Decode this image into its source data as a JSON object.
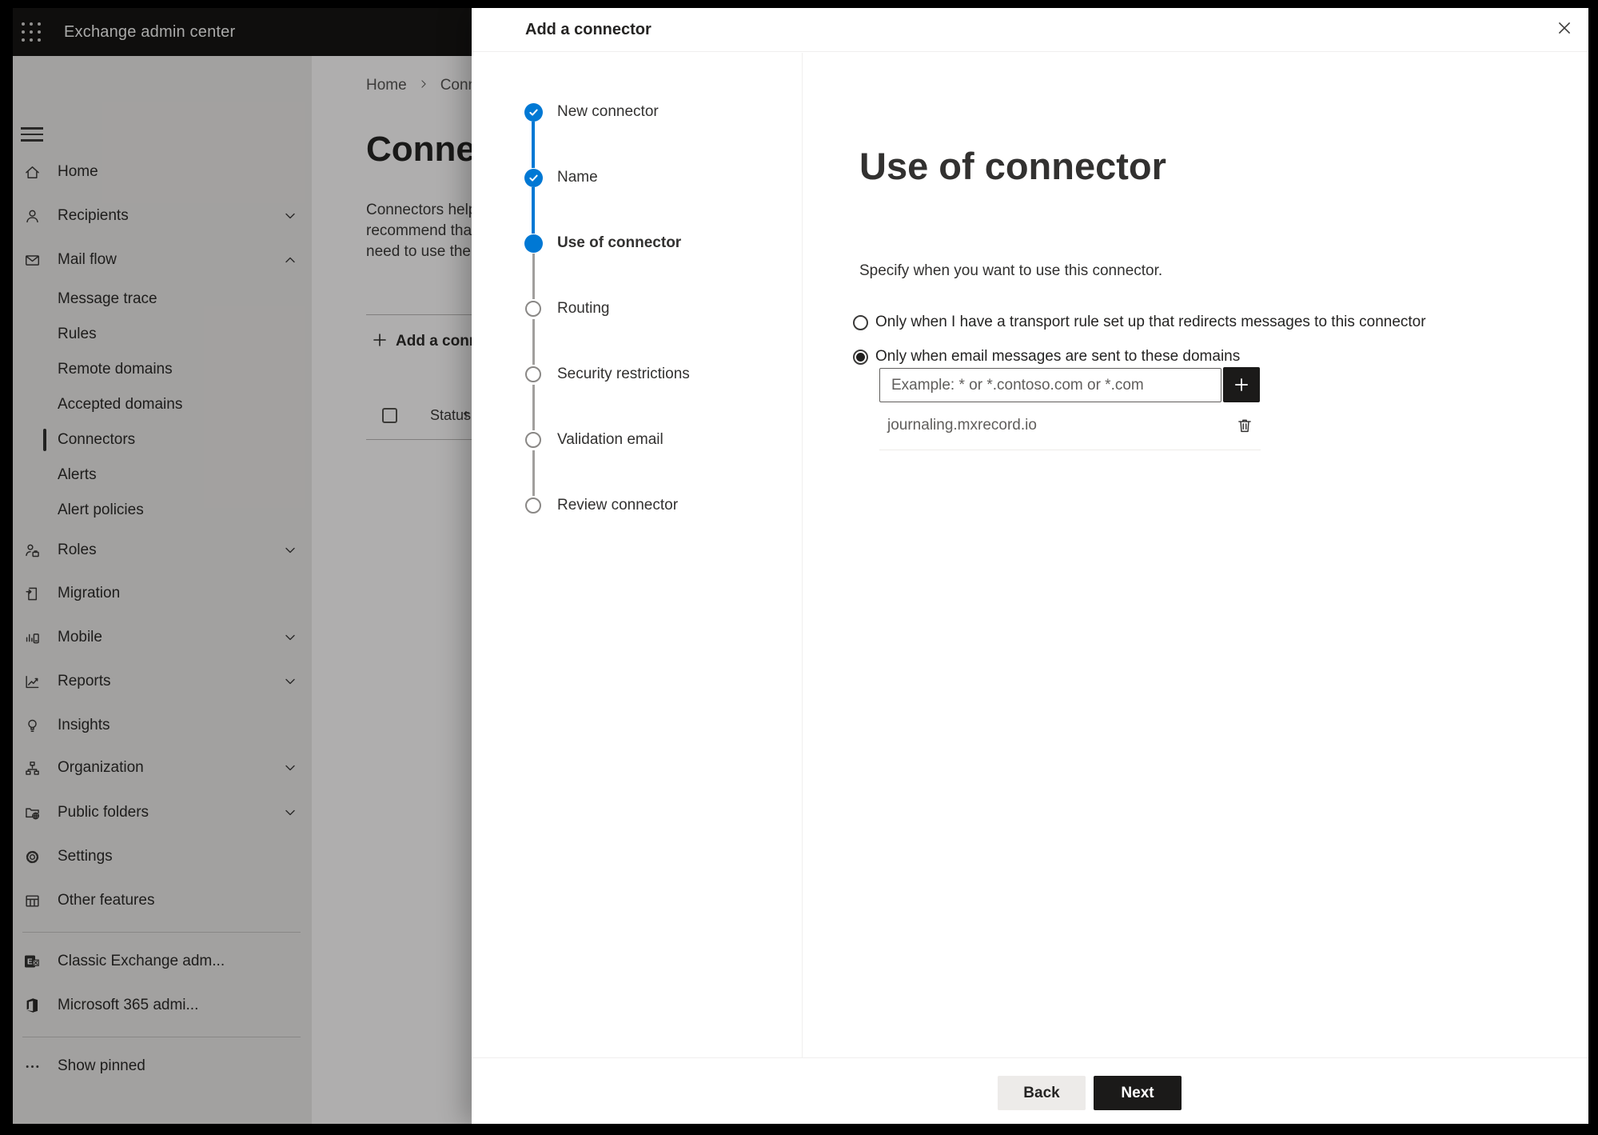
{
  "app": {
    "title": "Exchange admin center"
  },
  "sidebar": {
    "items": [
      {
        "label": "Home",
        "icon": "home-icon"
      },
      {
        "label": "Recipients",
        "icon": "person-icon",
        "chevron": "down"
      },
      {
        "label": "Mail flow",
        "icon": "mail-icon",
        "chevron": "up",
        "expanded": true
      },
      {
        "label": "Message trace",
        "sub": true
      },
      {
        "label": "Rules",
        "sub": true
      },
      {
        "label": "Remote domains",
        "sub": true
      },
      {
        "label": "Accepted domains",
        "sub": true
      },
      {
        "label": "Connectors",
        "sub": true,
        "selected": true
      },
      {
        "label": "Alerts",
        "sub": true
      },
      {
        "label": "Alert policies",
        "sub": true
      },
      {
        "label": "Roles",
        "icon": "roles-icon",
        "chevron": "down"
      },
      {
        "label": "Migration",
        "icon": "migration-icon"
      },
      {
        "label": "Mobile",
        "icon": "mobile-icon",
        "chevron": "down"
      },
      {
        "label": "Reports",
        "icon": "reports-icon",
        "chevron": "down"
      },
      {
        "label": "Insights",
        "icon": "lightbulb-icon"
      },
      {
        "label": "Organization",
        "icon": "org-icon",
        "chevron": "down"
      },
      {
        "label": "Public folders",
        "icon": "folder-globe-icon",
        "chevron": "down"
      },
      {
        "label": "Settings",
        "icon": "gear-icon"
      },
      {
        "label": "Other features",
        "icon": "table-icon"
      },
      {
        "label": "Classic Exchange adm...",
        "icon": "exchange-icon"
      },
      {
        "label": "Microsoft 365 admi...",
        "icon": "m365-icon"
      },
      {
        "label": "Show pinned",
        "icon": "ellipsis-icon"
      }
    ]
  },
  "background_page": {
    "breadcrumb": [
      "Home",
      "Conne"
    ],
    "page_title": "Connec",
    "description_lines": [
      "Connectors help",
      "recommend that",
      "need to use ther"
    ],
    "add_button_label": "Add a conn",
    "table_header_status": "Status"
  },
  "modal": {
    "title": "Add a connector",
    "steps": [
      {
        "label": "New connector",
        "state": "done"
      },
      {
        "label": "Name",
        "state": "done"
      },
      {
        "label": "Use of connector",
        "state": "current"
      },
      {
        "label": "Routing",
        "state": "upcoming"
      },
      {
        "label": "Security restrictions",
        "state": "upcoming"
      },
      {
        "label": "Validation email",
        "state": "upcoming"
      },
      {
        "label": "Review connector",
        "state": "upcoming"
      }
    ],
    "content": {
      "heading": "Use of connector",
      "description": "Specify when you want to use this connector.",
      "radio_options": [
        {
          "label": "Only when I have a transport rule set up that redirects messages to this connector",
          "selected": false
        },
        {
          "label": "Only when email messages are sent to these domains",
          "selected": true
        }
      ],
      "domain_input_placeholder": "Example: * or *.contoso.com or *.com",
      "domains": [
        "journaling.mxrecord.io"
      ]
    },
    "footer": {
      "back_label": "Back",
      "next_label": "Next"
    }
  },
  "colors": {
    "accent_blue": "#0078d4",
    "topbar": "#161514",
    "sidebar_bg": "#e9e7e5",
    "primary_button": "#1b1a19",
    "secondary_button": "#edebe9",
    "text_primary": "#323130",
    "text_secondary": "#605e5c"
  }
}
